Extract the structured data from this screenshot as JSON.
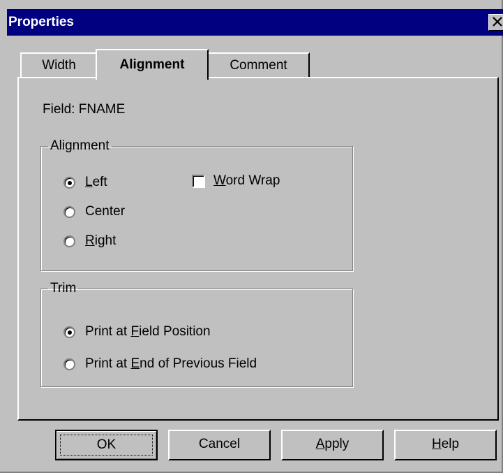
{
  "window": {
    "title": "Properties"
  },
  "tabs": [
    {
      "label": "Width",
      "active": false
    },
    {
      "label": "Alignment",
      "active": true
    },
    {
      "label": "Comment",
      "active": false
    }
  ],
  "field": {
    "label": "Field:",
    "value": "FNAME"
  },
  "alignment_group": {
    "legend": "Alignment",
    "options": [
      {
        "pre": "",
        "mnemonic": "L",
        "post": "eft",
        "selected": true
      },
      {
        "pre": "Center",
        "mnemonic": "",
        "post": "",
        "selected": false
      },
      {
        "pre": "",
        "mnemonic": "R",
        "post": "ight",
        "selected": false
      }
    ],
    "word_wrap": {
      "pre": "",
      "mnemonic": "W",
      "post": "ord Wrap",
      "checked": false
    }
  },
  "trim_group": {
    "legend": "Trim",
    "options": [
      {
        "pre": "Print at ",
        "mnemonic": "F",
        "post": "ield Position",
        "selected": true
      },
      {
        "pre": "Print at ",
        "mnemonic": "E",
        "post": "nd of Previous Field",
        "selected": false
      }
    ]
  },
  "buttons": {
    "ok": "OK",
    "cancel": "Cancel",
    "apply": {
      "pre": "",
      "mnemonic": "A",
      "post": "pply"
    },
    "help": {
      "pre": "",
      "mnemonic": "H",
      "post": "elp"
    }
  }
}
